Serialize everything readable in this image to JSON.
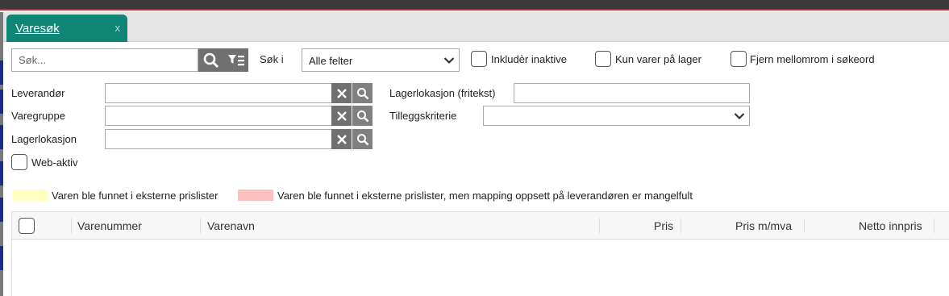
{
  "tab": {
    "label": "Varesøk",
    "close": "x"
  },
  "search": {
    "placeholder": "Søk...",
    "sok_i_label": "Søk i",
    "sok_i_value": "Alle felter",
    "include_inactive": "Inkludèr inaktive",
    "only_in_stock": "Kun varer på lager",
    "remove_spaces": "Fjern mellomrom i søkeord"
  },
  "filters": {
    "supplier": "Leverandør",
    "item_group": "Varegruppe",
    "stock_location": "Lagerlokasjon",
    "stock_location_free": "Lagerlokasjon (fritekst)",
    "extra_criteria": "Tilleggskriterie",
    "web_active": "Web-aktiv"
  },
  "legend": {
    "yellow_color": "#ffffc0",
    "yellow_text": "Varen ble funnet i eksterne prislister",
    "red_color": "#ffc0c0",
    "red_text": "Varen ble funnet i eksterne prislister, men mapping oppsett på leverandøren er mangelfult"
  },
  "grid": {
    "columns": [
      "Varenummer",
      "Varenavn",
      "Pris",
      "Pris m/mva",
      "Netto innpris"
    ]
  }
}
